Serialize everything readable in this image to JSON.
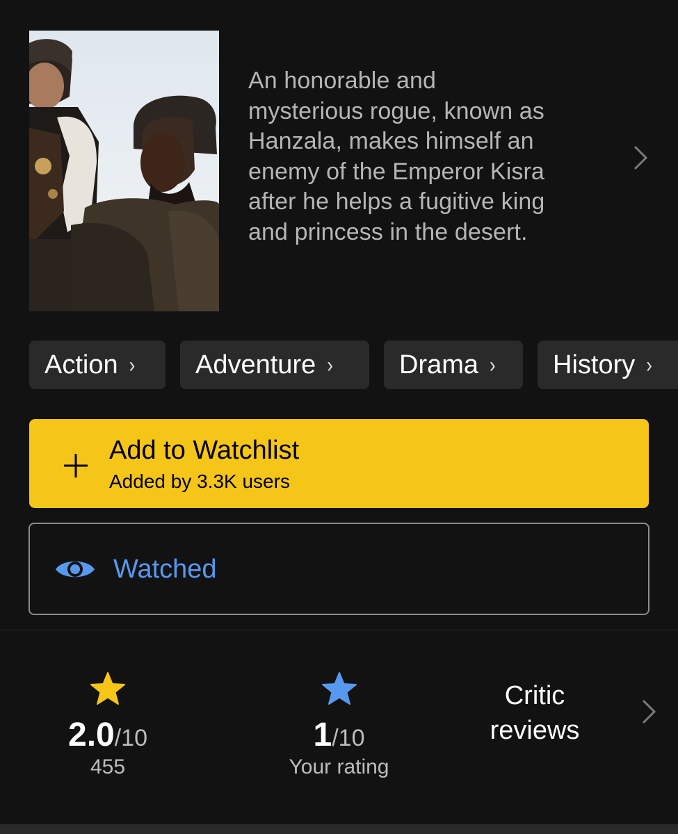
{
  "synopsis": {
    "lines": [
      "An honorable and",
      "mysterious rogue, known as",
      "Hanzala, makes himself an",
      "enemy of the Emperor Kisra",
      "after he helps a fugitive king",
      "and princess in the desert."
    ]
  },
  "genres": [
    {
      "label": "Action"
    },
    {
      "label": "Adventure"
    },
    {
      "label": "Drama"
    },
    {
      "label": "History"
    }
  ],
  "watchlist": {
    "title": "Add to Watchlist",
    "subtitle": "Added by 3.3K users",
    "icon": "plus-icon",
    "color": "#f5c518"
  },
  "watched": {
    "label": "Watched",
    "icon": "eye-icon",
    "color": "#5799ef"
  },
  "ratings": {
    "imdb": {
      "value": "2.0",
      "scale": "/10",
      "count": "455",
      "star_color": "#f5c518"
    },
    "user": {
      "value": "1",
      "scale": "/10",
      "label": "Your rating",
      "star_color": "#5799ef"
    },
    "critic": {
      "line1": "Critic",
      "line2": "reviews"
    }
  },
  "icons": [
    "chevron-right-icon",
    "plus-icon",
    "eye-icon",
    "star-icon"
  ]
}
